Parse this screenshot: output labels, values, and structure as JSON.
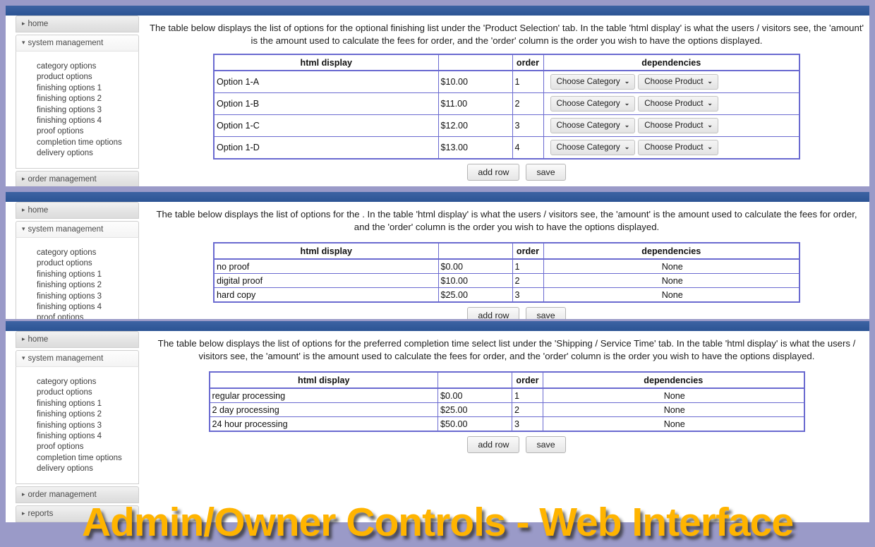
{
  "theme": {
    "page_background": "#9a9ac8",
    "panel_topbar": "#2f5597",
    "table_border": "#6a6ad0",
    "caption_color": "#ffb400"
  },
  "caption": "Admin/Owner Controls - Web Interface",
  "sidebar": {
    "home_label": "home",
    "system_management_label": "system management",
    "order_management_label": "order management",
    "reports_label": "reports",
    "collapsed_marker": "▸",
    "expanded_marker": "▾",
    "items": [
      "category options",
      "product options",
      "finishing options 1",
      "finishing options 2",
      "finishing options 3",
      "finishing options 4",
      "proof options",
      "completion time options",
      "delivery options"
    ],
    "items_truncated": [
      "category options",
      "product options",
      "finishing options 1",
      "finishing options 2",
      "finishing options 3",
      "finishing options 4",
      "proof options"
    ]
  },
  "buttons": {
    "add_row": "add row",
    "save": "save"
  },
  "table_headers": {
    "html_display": "html display",
    "amount": "",
    "order": "order",
    "dependencies": "dependencies"
  },
  "dropdowns": {
    "category": "Choose Category",
    "product": "Choose Product",
    "chevron": "⌵"
  },
  "panels": [
    {
      "description": "The table below displays the list of options for the optional finishing list under the 'Product Selection' tab. In the table 'html display' is what the users / visitors see, the 'amount' is the amount used to calculate the fees for order, and the 'order' column is the order you wish to have the options displayed.",
      "rows": [
        {
          "html_display": "Option 1-A",
          "amount": "$10.00",
          "order": "1",
          "dependencies": "dropdowns"
        },
        {
          "html_display": "Option 1-B",
          "amount": "$11.00",
          "order": "2",
          "dependencies": "dropdowns"
        },
        {
          "html_display": "Option 1-C",
          "amount": "$12.00",
          "order": "3",
          "dependencies": "dropdowns"
        },
        {
          "html_display": "Option 1-D",
          "amount": "$13.00",
          "order": "4",
          "dependencies": "dropdowns"
        }
      ]
    },
    {
      "description": "The table below displays the list of options for the . In the table 'html display' is what the users / visitors see, the 'amount' is the amount used to calculate the fees for order, and the 'order' column is the order you wish to have the options displayed.",
      "rows": [
        {
          "html_display": "no proof",
          "amount": "$0.00",
          "order": "1",
          "dependencies": "None"
        },
        {
          "html_display": "digital proof",
          "amount": "$10.00",
          "order": "2",
          "dependencies": "None"
        },
        {
          "html_display": "hard copy",
          "amount": "$25.00",
          "order": "3",
          "dependencies": "None"
        }
      ]
    },
    {
      "description": "The table below displays the list of options for the preferred completion time select list under the 'Shipping / Service Time' tab. In the table 'html display' is what the users / visitors see, the 'amount' is the amount used to calculate the fees for order, and the 'order' column is the order you wish to have the options displayed.",
      "rows": [
        {
          "html_display": "regular processing",
          "amount": "$0.00",
          "order": "1",
          "dependencies": "None"
        },
        {
          "html_display": "2 day processing",
          "amount": "$25.00",
          "order": "2",
          "dependencies": "None"
        },
        {
          "html_display": "24 hour processing",
          "amount": "$50.00",
          "order": "3",
          "dependencies": "None"
        }
      ]
    }
  ]
}
